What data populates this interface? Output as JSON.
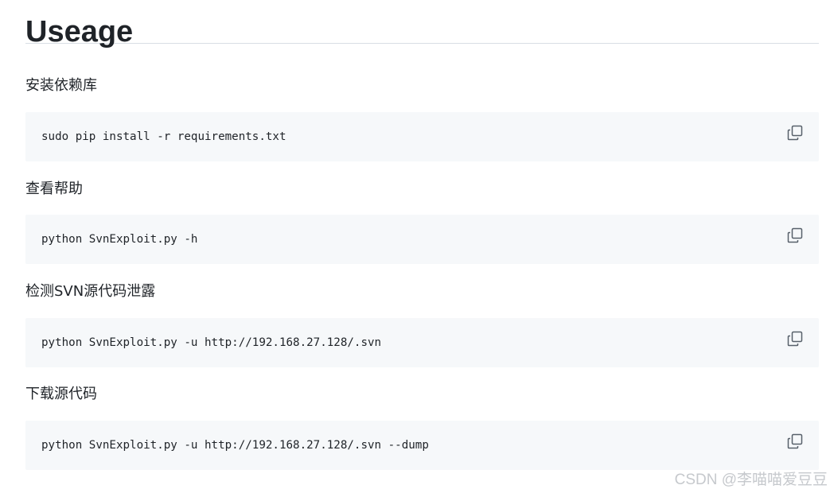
{
  "heading": "Useage",
  "steps": [
    {
      "label": "安装依赖库",
      "command": "sudo pip install -r requirements.txt",
      "copy_icon": "copy-icon"
    },
    {
      "label": "查看帮助",
      "command": "python SvnExploit.py -h",
      "copy_icon": "copy-icon"
    },
    {
      "label": "检测SVN源代码泄露",
      "command": "python SvnExploit.py -u http://192.168.27.128/.svn",
      "copy_icon": "copy-icon"
    },
    {
      "label": "下载源代码",
      "command": "python SvnExploit.py -u http://192.168.27.128/.svn --dump",
      "copy_icon": "copy-icon"
    }
  ],
  "watermark": "CSDN @李喵喵爱豆豆",
  "colors": {
    "text": "#1f2328",
    "code_background": "#f6f8fa",
    "divider": "#d8dee4",
    "icon": "#57606a",
    "watermark": "#c6c9cd"
  }
}
